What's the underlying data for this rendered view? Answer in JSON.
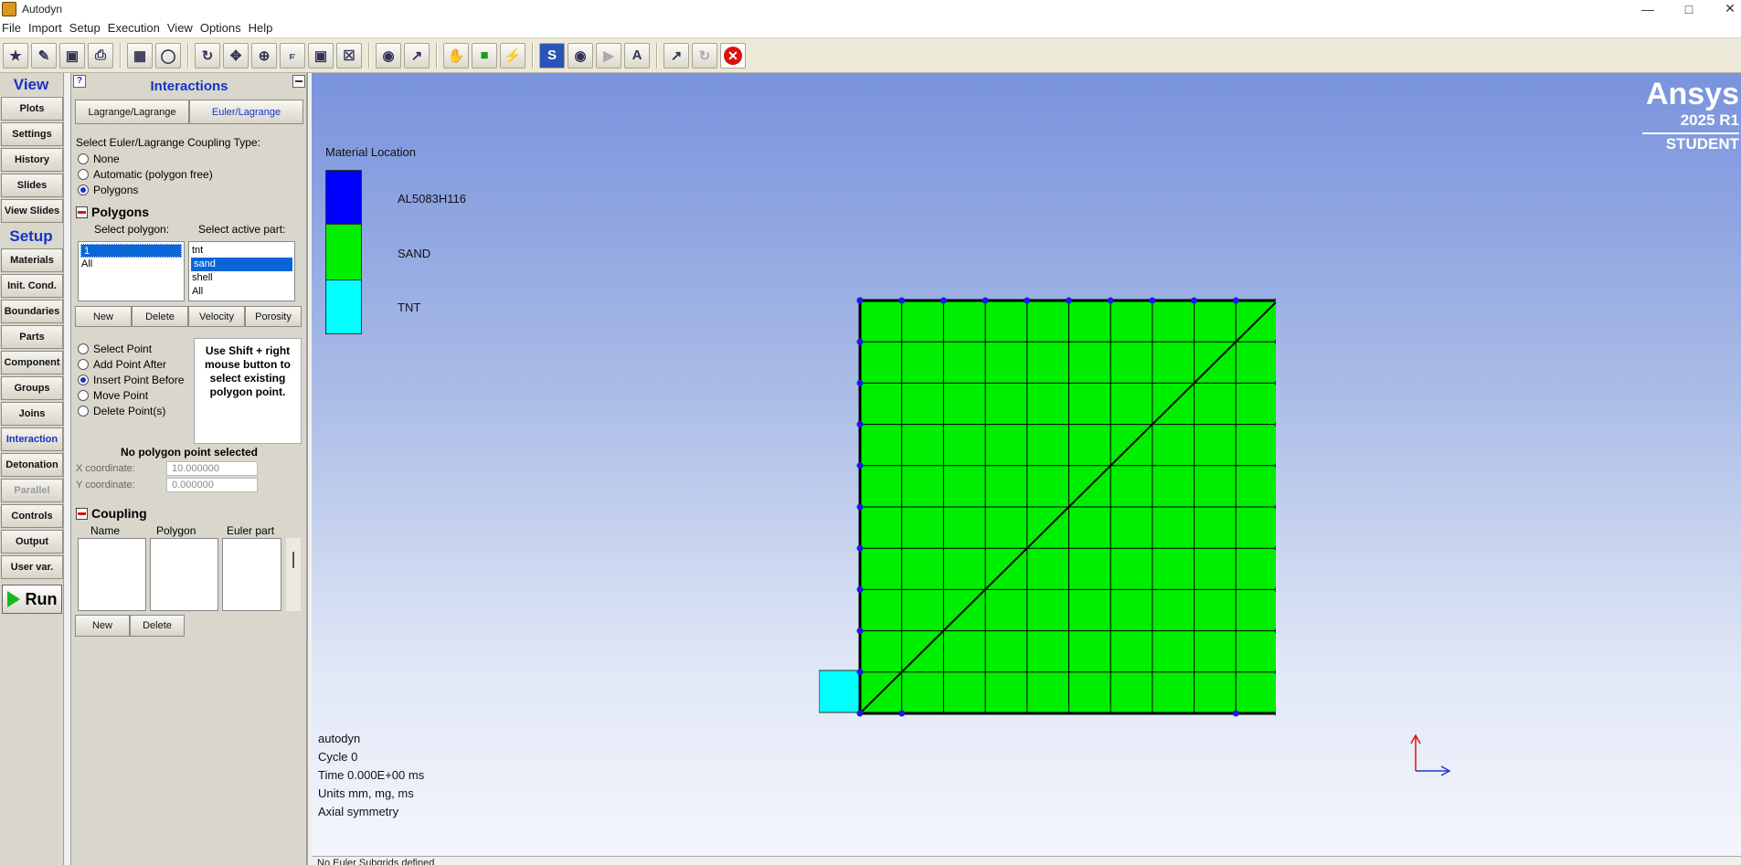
{
  "window": {
    "title": "Autodyn"
  },
  "menu": [
    "File",
    "Import",
    "Setup",
    "Execution",
    "View",
    "Options",
    "Help"
  ],
  "toolbar": {
    "icons": [
      "new-icon",
      "open-icon",
      "save-icon",
      "print-icon",
      "grid-icon",
      "zoom-box-icon",
      "rotate-icon",
      "pan-icon",
      "zoom-icon",
      "axis-icon",
      "fit-icon",
      "fit-all-icon",
      "eye-icon",
      "chart-icon",
      "hand-icon",
      "box-icon",
      "lightning-icon",
      "slide-icon",
      "camera-icon",
      "play-icon",
      "text-icon",
      "export-icon",
      "refresh-icon",
      "close-icon"
    ]
  },
  "nav": {
    "view_header": "View",
    "view_items": [
      "Plots",
      "Settings",
      "History",
      "Slides",
      "View Slides"
    ],
    "setup_header": "Setup",
    "setup_items": [
      "Materials",
      "Init. Cond.",
      "Boundaries",
      "Parts",
      "Component",
      "Groups",
      "Joins",
      "Interaction",
      "Detonation",
      "Parallel",
      "Controls",
      "Output",
      "User var."
    ],
    "active_item": "Interaction",
    "disabled_item": "Parallel",
    "run_label": "Run"
  },
  "panel": {
    "help_label": "?",
    "title": "Interactions",
    "tabs": [
      "Lagrange/Lagrange",
      "Euler/Lagrange"
    ],
    "active_tab": "Euler/Lagrange",
    "coupling_type_label": "Select Euler/Lagrange Coupling Type:",
    "coupling_types": [
      "None",
      "Automatic (polygon free)",
      "Polygons"
    ],
    "coupling_type_selected": "Polygons",
    "polygons": {
      "title": "Polygons",
      "select_polygon_label": "Select polygon:",
      "select_part_label": "Select active part:",
      "polygon_list": [
        "1",
        "All"
      ],
      "polygon_selected": "1",
      "part_list": [
        "tnt",
        "sand",
        "shell",
        "All"
      ],
      "part_selected": "sand",
      "buttons": [
        "New",
        "Delete",
        "Velocity",
        "Porosity"
      ],
      "point_modes": [
        "Select Point",
        "Add Point After",
        "Insert Point Before",
        "Move Point",
        "Delete Point(s)"
      ],
      "point_mode_selected": "Insert Point Before",
      "hint": "Use Shift + right mouse button to select existing polygon point.",
      "point_status": "No polygon point selected",
      "x_label": "X coordinate:",
      "x_value": "10.000000",
      "y_label": "Y coordinate:",
      "y_value": "0.000000"
    },
    "coupling": {
      "title": "Coupling",
      "columns": [
        "Name",
        "Polygon",
        "Euler part"
      ],
      "buttons": [
        "New",
        "Delete"
      ]
    }
  },
  "viewport": {
    "legend_title": "Material Location",
    "legend": [
      {
        "name": "AL5083H116",
        "color": "#0000ff"
      },
      {
        "name": "SAND",
        "color": "#00ee00"
      },
      {
        "name": "TNT",
        "color": "#00ffff"
      }
    ],
    "brand": "Ansys",
    "version": "2025 R1",
    "edition": "STUDENT",
    "info": [
      "autodyn",
      "Cycle 0",
      "Time 0.000E+00 ms",
      "Units mm, mg, ms",
      "Axial symmetry"
    ],
    "grid_cells": 10
  },
  "status": "No Euler Subgrids defined"
}
